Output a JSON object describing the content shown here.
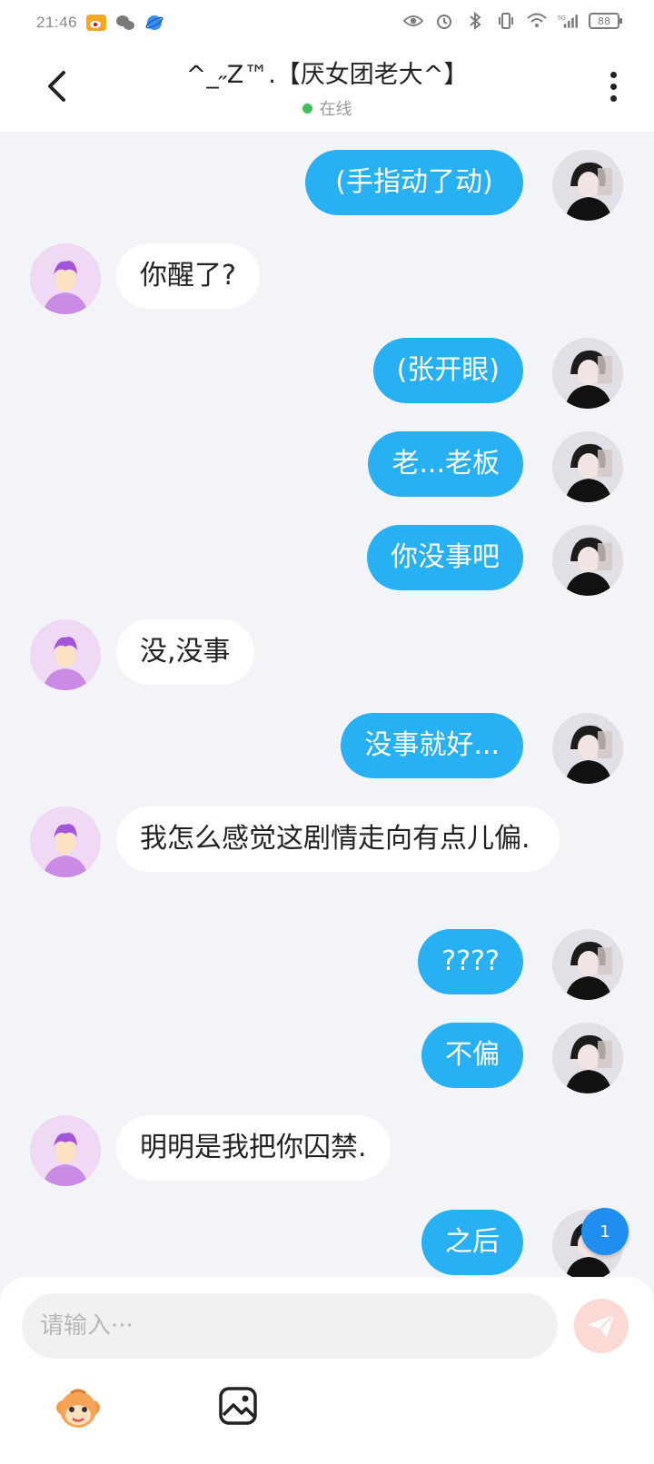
{
  "status_bar": {
    "time": "21:46",
    "battery": "88",
    "network": "5G"
  },
  "header": {
    "title": "^_˶Z™.【厌女团老大^】",
    "status": "在线"
  },
  "messages": [
    {
      "side": "me",
      "text": "(手指动了动)"
    },
    {
      "side": "other",
      "text": "你醒了?"
    },
    {
      "side": "me",
      "text": "(张开眼)"
    },
    {
      "side": "me",
      "text": "老...老板"
    },
    {
      "side": "me",
      "text": "你没事吧"
    },
    {
      "side": "other",
      "text": "没,没事"
    },
    {
      "side": "me",
      "text": "没事就好..."
    },
    {
      "side": "other",
      "text": "我怎么感觉这剧情走向有点儿偏."
    },
    {
      "side": "me",
      "text": "????"
    },
    {
      "side": "me",
      "text": "不偏"
    },
    {
      "side": "other",
      "text": "明明是我把你囚禁."
    },
    {
      "side": "me",
      "text": "之后"
    }
  ],
  "unread_badge": "1",
  "input": {
    "placeholder": "请输入···"
  },
  "colors": {
    "my_bubble": "#28b0f5",
    "other_bubble": "#ffffff",
    "online_dot": "#3cc05a",
    "send_button": "#fcd9d4"
  }
}
